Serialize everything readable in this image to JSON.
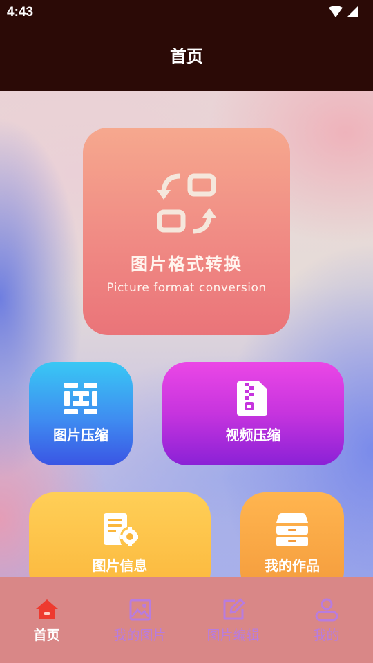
{
  "status_bar": {
    "time": "4:43"
  },
  "header": {
    "title": "首页"
  },
  "cards": {
    "format_conversion": {
      "title": "图片格式转换",
      "subtitle": "Picture format conversion"
    },
    "image_compress": {
      "title": "图片压缩"
    },
    "video_compress": {
      "title": "视频压缩"
    },
    "image_info": {
      "title": "图片信息"
    },
    "my_works": {
      "title": "我的作品"
    }
  },
  "tabbar": {
    "items": [
      {
        "label": "首页",
        "icon": "home-icon",
        "active": true
      },
      {
        "label": "我的图片",
        "icon": "picture-icon",
        "active": false
      },
      {
        "label": "图片编辑",
        "icon": "edit-icon",
        "active": false
      },
      {
        "label": "我的",
        "icon": "user-icon",
        "active": false
      }
    ]
  },
  "colors": {
    "header_bg": "#2b0a06",
    "tabbar_bg": "#d98787",
    "tab_active": "#ffffff",
    "tab_inactive": "#b87cde",
    "home_icon": "#ee3a2f"
  }
}
